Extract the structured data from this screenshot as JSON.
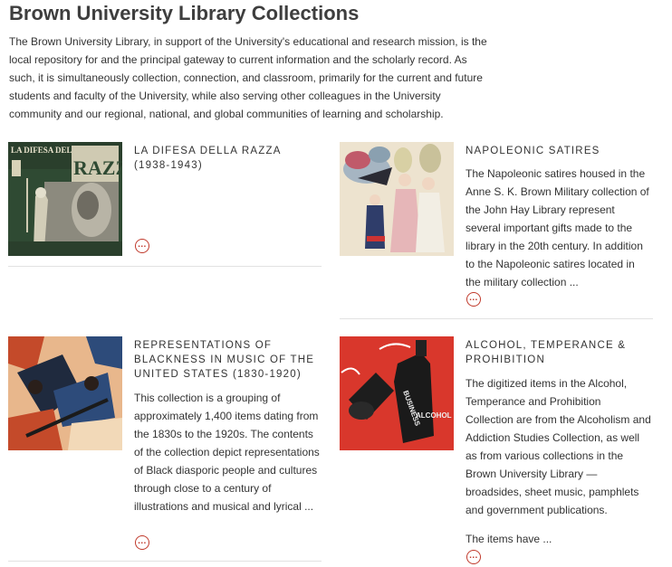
{
  "page": {
    "title": "Brown University Library Collections",
    "intro": "The Brown University Library, in support of the University's educational and research mission, is the local repository for and the principal gateway to current information and the scholarly record. As such, it is simultaneously collection, connection, and classroom, primarily for the current and future students and faculty of the University, while also serving other colleagues in the University community and our regional, national, and global communities of learning and scholarship."
  },
  "collections": [
    {
      "title": "La Difesa della Razza (1938-1943)",
      "description": "",
      "more_label": "…",
      "thumb_text": [
        "LA DIFESA DELLA",
        "RAZZA"
      ]
    },
    {
      "title": "Napoleonic Satires",
      "description": "The Napoleonic satires housed in the Anne S. K. Brown Military collection of the John Hay Library represent several important gifts made to the library in the 20th century. In addition to the Napoleonic satires located in the military collection ...",
      "more_label": "…"
    },
    {
      "title": "Representations of Blackness in Music of the United States (1830-1920)",
      "description": "This collection is a grouping of approximately 1,400 items dating from the 1830s to the 1920s. The contents of the collection depict representations of Black diasporic people and cultures through close to a century of illustrations and musical and lyrical ...",
      "more_label": "…"
    },
    {
      "title": "Alcohol, Temperance & Prohibition",
      "description": "The digitized items in the Alcohol, Temperance and Prohibition Collection are from the Alcoholism and Addiction Studies Collection, as well as from various collections in the Brown University Library — broadsides, sheet music, pamphlets and government publications.",
      "description_2": "The items have ...",
      "more_label": "…",
      "thumb_text": [
        "BUSINESS",
        "ALCOHOL"
      ]
    }
  ],
  "colors": {
    "accent": "#c0392b",
    "title": "#3e3e3e",
    "text": "#333333",
    "divider": "#e2e2e2"
  }
}
